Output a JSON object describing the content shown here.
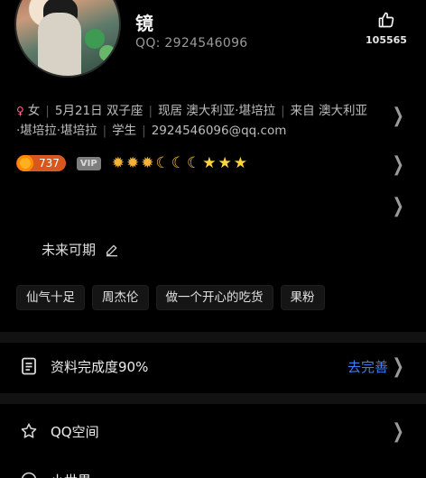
{
  "profile": {
    "name": "镜",
    "qq_label": "QQ:",
    "qq_number": "2924546096",
    "like_count": "105565"
  },
  "info": {
    "gender": "女",
    "birthday": "5月21日",
    "zodiac": "双子座",
    "residence": "现居 澳大利亚·堪培拉",
    "hometown_a": "来自 澳大利亚",
    "hometown_b": "·堪培拉·堪培拉",
    "occupation": "学生",
    "email": "2924546096@qq.com"
  },
  "level": {
    "value": "737",
    "vip_label": "VIP",
    "icons": [
      "sun",
      "sun",
      "sun",
      "moon",
      "moon",
      "moon",
      "star",
      "star",
      "star"
    ]
  },
  "signature": {
    "text": "未来可期"
  },
  "tags": [
    "仙气十足",
    "周杰伦",
    "做一个开心的吃货",
    "果粉"
  ],
  "list": {
    "completion_label": "资料完成度90%",
    "completion_action": "去完善",
    "qzone_label": "QQ空间",
    "third_label": "小世界"
  }
}
